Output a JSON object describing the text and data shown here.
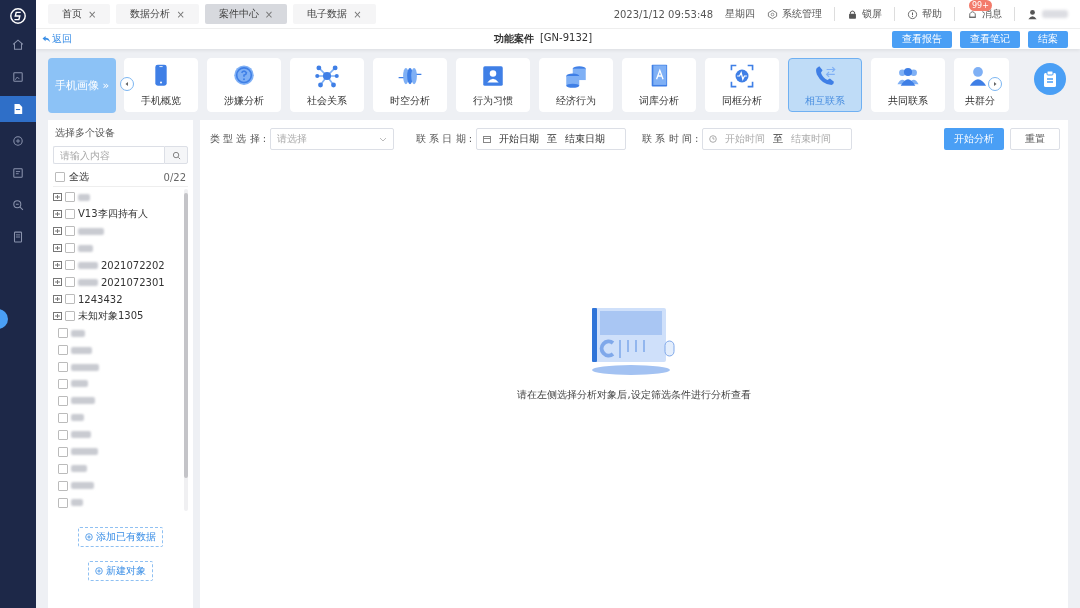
{
  "nav": [
    {
      "selected": false
    },
    {
      "selected": false
    },
    {
      "selected": true
    },
    {
      "selected": false
    },
    {
      "selected": false
    },
    {
      "selected": false
    },
    {
      "selected": false
    }
  ],
  "tabs": [
    {
      "label": "首页",
      "close": "×",
      "selected": false
    },
    {
      "label": "数据分析",
      "close": "×",
      "selected": false
    },
    {
      "label": "案件中心",
      "close": "×",
      "selected": true
    },
    {
      "label": "电子数据",
      "close": "×",
      "selected": false
    }
  ],
  "header": {
    "datetime": "2023/1/12 09:53:48",
    "weekday": "星期四",
    "links": [
      "系统管理",
      "锁屏",
      "帮助",
      "消息"
    ],
    "badge": "99+"
  },
  "subbar": {
    "back": "返回",
    "title": "功能案件",
    "code": "[GN-9132]",
    "buttons": [
      "查看报告",
      "查看笔记",
      "结案"
    ]
  },
  "module": {
    "title": "手机画像",
    "chevron": "»"
  },
  "functions": [
    {
      "label": "手机概览",
      "selected": false
    },
    {
      "label": "涉嫌分析",
      "selected": false
    },
    {
      "label": "社会关系",
      "selected": false
    },
    {
      "label": "时空分析",
      "selected": false
    },
    {
      "label": "行为习惯",
      "selected": false
    },
    {
      "label": "经济行为",
      "selected": false
    },
    {
      "label": "词库分析",
      "selected": false
    },
    {
      "label": "同框分析",
      "selected": false
    },
    {
      "label": "相互联系",
      "selected": true
    },
    {
      "label": "共同联系",
      "selected": false
    },
    {
      "label": "共群分",
      "selected": false
    }
  ],
  "devices": {
    "title": "选择多个设备",
    "search_placeholder": "请输入内容",
    "select_all": {
      "label": "全选",
      "checked": false
    },
    "count": "0/22",
    "items": [
      {
        "kind": "group",
        "redacted": true,
        "checked": false
      },
      {
        "kind": "group",
        "label": "V13李四持有人",
        "redacted": false,
        "checked": false
      },
      {
        "kind": "group",
        "redacted": true,
        "checked": false
      },
      {
        "kind": "group",
        "redacted": true,
        "checked": false
      },
      {
        "kind": "group",
        "label": "2021072202",
        "redacted": true,
        "checked": false
      },
      {
        "kind": "group",
        "label": "2021072301",
        "redacted": true,
        "checked": false
      },
      {
        "kind": "group",
        "label": "1243432",
        "redacted": false,
        "checked": false
      },
      {
        "kind": "group",
        "label": "未知对象1305",
        "redacted": false,
        "checked": false
      },
      {
        "kind": "plain",
        "redacted": true,
        "checked": false
      },
      {
        "kind": "plain",
        "redacted": true,
        "checked": false
      },
      {
        "kind": "plain",
        "redacted": true,
        "checked": false
      },
      {
        "kind": "plain",
        "redacted": true,
        "checked": false
      },
      {
        "kind": "plain",
        "redacted": true,
        "checked": false
      },
      {
        "kind": "plain",
        "redacted": true,
        "checked": false
      },
      {
        "kind": "plain",
        "redacted": true,
        "checked": false
      },
      {
        "kind": "plain",
        "redacted": true,
        "checked": false
      },
      {
        "kind": "plain",
        "redacted": true,
        "checked": false
      },
      {
        "kind": "plain",
        "redacted": true,
        "checked": false
      },
      {
        "kind": "plain",
        "redacted": true,
        "checked": false
      }
    ],
    "buttons": [
      "添加已有数据",
      "新建对象"
    ]
  },
  "filters": {
    "type_label": "类 型 选 择 :",
    "type_placeholder": "请选择",
    "date_label": "联 系 日 期 :",
    "date_start": "开始日期",
    "date_sep": "至",
    "date_end": "结束日期",
    "time_label": "联 系 时 间 :",
    "time_start": "开始时间",
    "time_sep": "至",
    "time_end": "结束时间",
    "buttons": [
      "开始分析",
      "重置"
    ]
  },
  "empty_message": "请在左侧选择分析对象后,设定筛选条件进行分析查看"
}
